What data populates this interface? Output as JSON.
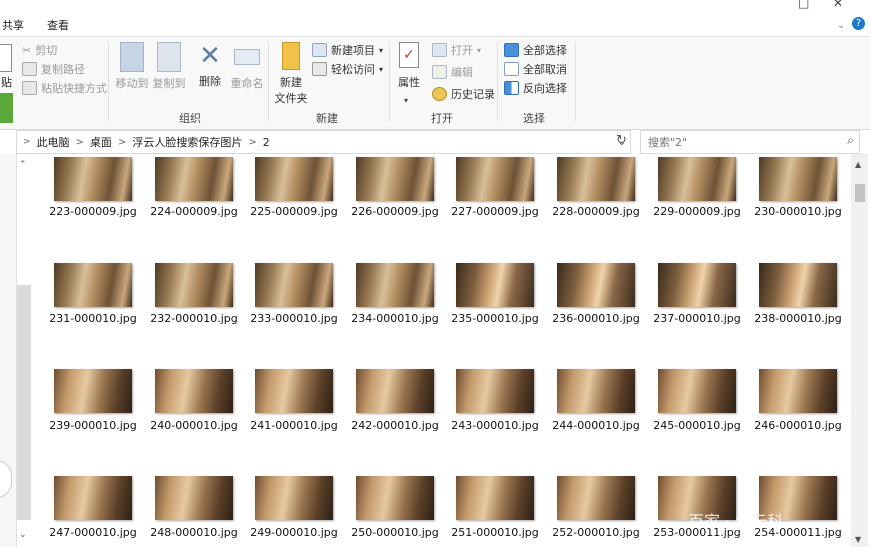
{
  "tabs": {
    "share": "共享",
    "view": "查看"
  },
  "window": {
    "maximize": "□",
    "close": "✕",
    "help": "?"
  },
  "ribbon": {
    "clipboard": {
      "paste": "贴",
      "cut": "剪切",
      "copy_path": "复制路径",
      "paste_shortcut": "粘贴快捷方式"
    },
    "organize": {
      "move_to": "移动到",
      "copy_to": "复制到",
      "delete": "删除",
      "rename": "重命名",
      "label": "组织"
    },
    "new": {
      "new_folder_line1": "新建",
      "new_folder_line2": "文件夹",
      "new_item": "新建项目",
      "easy_access": "轻松访问",
      "label": "新建"
    },
    "open": {
      "properties": "属性",
      "open": "打开",
      "edit": "编辑",
      "history": "历史记录",
      "label": "打开"
    },
    "select": {
      "select_all": "全部选择",
      "select_none": "全部取消",
      "invert": "反向选择",
      "label": "选择"
    }
  },
  "address": {
    "crumbs": [
      "此电脑",
      "桌面",
      "浮云人脸搜索保存图片",
      "2"
    ]
  },
  "search": {
    "placeholder": "搜索\"2\""
  },
  "files": [
    [
      "223-000009.jpg",
      "224-000009.jpg",
      "225-000009.jpg",
      "226-000009.jpg",
      "227-000009.jpg",
      "228-000009.jpg",
      "229-000009.jpg",
      "230-000010.jpg"
    ],
    [
      "231-000010.jpg",
      "232-000010.jpg",
      "233-000010.jpg",
      "234-000010.jpg",
      "235-000010.jpg",
      "236-000010.jpg",
      "237-000010.jpg",
      "238-000010.jpg"
    ],
    [
      "239-000010.jpg",
      "240-000010.jpg",
      "241-000010.jpg",
      "242-000010.jpg",
      "243-000010.jpg",
      "244-000010.jpg",
      "245-000010.jpg",
      "246-000010.jpg"
    ],
    [
      "247-000010.jpg",
      "248-000010.jpg",
      "249-000010.jpg",
      "250-000010.jpg",
      "251-000010.jpg",
      "252-000010.jpg",
      "253-000011.jpg",
      "254-000011.jpg"
    ]
  ],
  "watermark": "百家 · 浮云科",
  "colors": {
    "accent": "#1979ca",
    "folder": "#f0c24a",
    "delete": "#5a7ea8"
  }
}
